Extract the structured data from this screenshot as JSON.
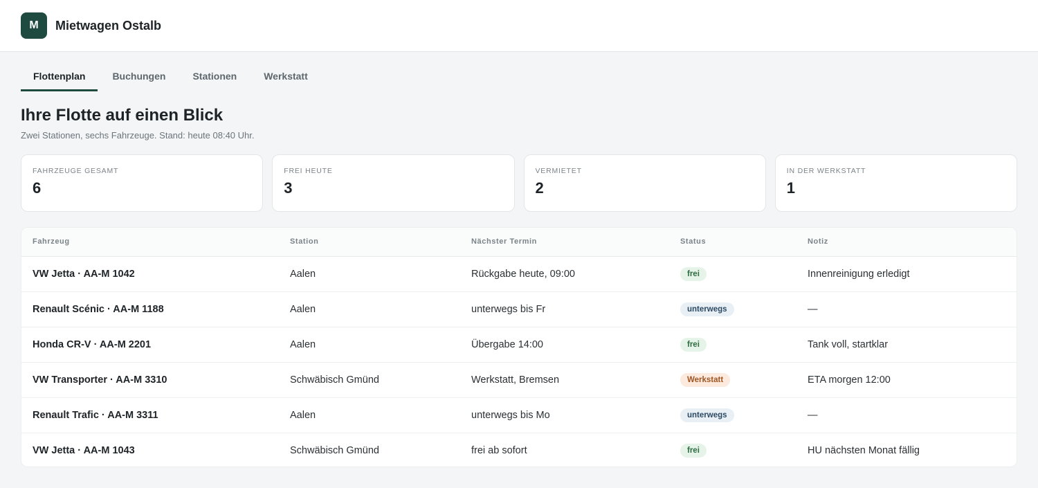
{
  "header": {
    "logo_letter": "M",
    "brand": "Mietwagen Ostalb",
    "brand_color": "#1f4a3f"
  },
  "tabs": [
    {
      "label": "Flottenplan",
      "active": true
    },
    {
      "label": "Buchungen",
      "active": false
    },
    {
      "label": "Stationen",
      "active": false
    },
    {
      "label": "Werkstatt",
      "active": false
    }
  ],
  "page": {
    "title": "Ihre Flotte auf einen Blick",
    "subtitle": "Zwei Stationen, sechs Fahrzeuge. Stand: heute 08:40 Uhr."
  },
  "stats": [
    {
      "label": "FAHRZEUGE GESAMT",
      "value": "6"
    },
    {
      "label": "FREI HEUTE",
      "value": "3"
    },
    {
      "label": "VERMIETET",
      "value": "2"
    },
    {
      "label": "IN DER WERKSTATT",
      "value": "1"
    }
  ],
  "table": {
    "headers": [
      "Fahrzeug",
      "Station",
      "Nächster Termin",
      "Status",
      "Notiz"
    ],
    "rows": [
      {
        "vehicle": "VW Jetta · AA-M 1042",
        "station": "Aalen",
        "next": "Rückgabe heute, 09:00",
        "status": "frei",
        "status_kind": "frei",
        "note": "Innenreinigung erledigt"
      },
      {
        "vehicle": "Renault Scénic · AA-M 1188",
        "station": "Aalen",
        "next": "unterwegs bis Fr",
        "status": "unterwegs",
        "status_kind": "unterwegs",
        "note": "—"
      },
      {
        "vehicle": "Honda CR-V · AA-M 2201",
        "station": "Aalen",
        "next": "Übergabe 14:00",
        "status": "frei",
        "status_kind": "frei",
        "note": "Tank voll, startklar"
      },
      {
        "vehicle": "VW Transporter · AA-M 3310",
        "station": "Schwäbisch Gmünd",
        "next": "Werkstatt, Bremsen",
        "status": "Werkstatt",
        "status_kind": "werkstatt",
        "note": "ETA morgen 12:00"
      },
      {
        "vehicle": "Renault Trafic · AA-M 3311",
        "station": "Aalen",
        "next": "unterwegs bis Mo",
        "status": "unterwegs",
        "status_kind": "unterwegs",
        "note": "—"
      },
      {
        "vehicle": "VW Jetta · AA-M 1043",
        "station": "Schwäbisch Gmünd",
        "next": "frei ab sofort",
        "status": "frei",
        "status_kind": "frei",
        "note": "HU nächsten Monat fällig"
      }
    ]
  }
}
